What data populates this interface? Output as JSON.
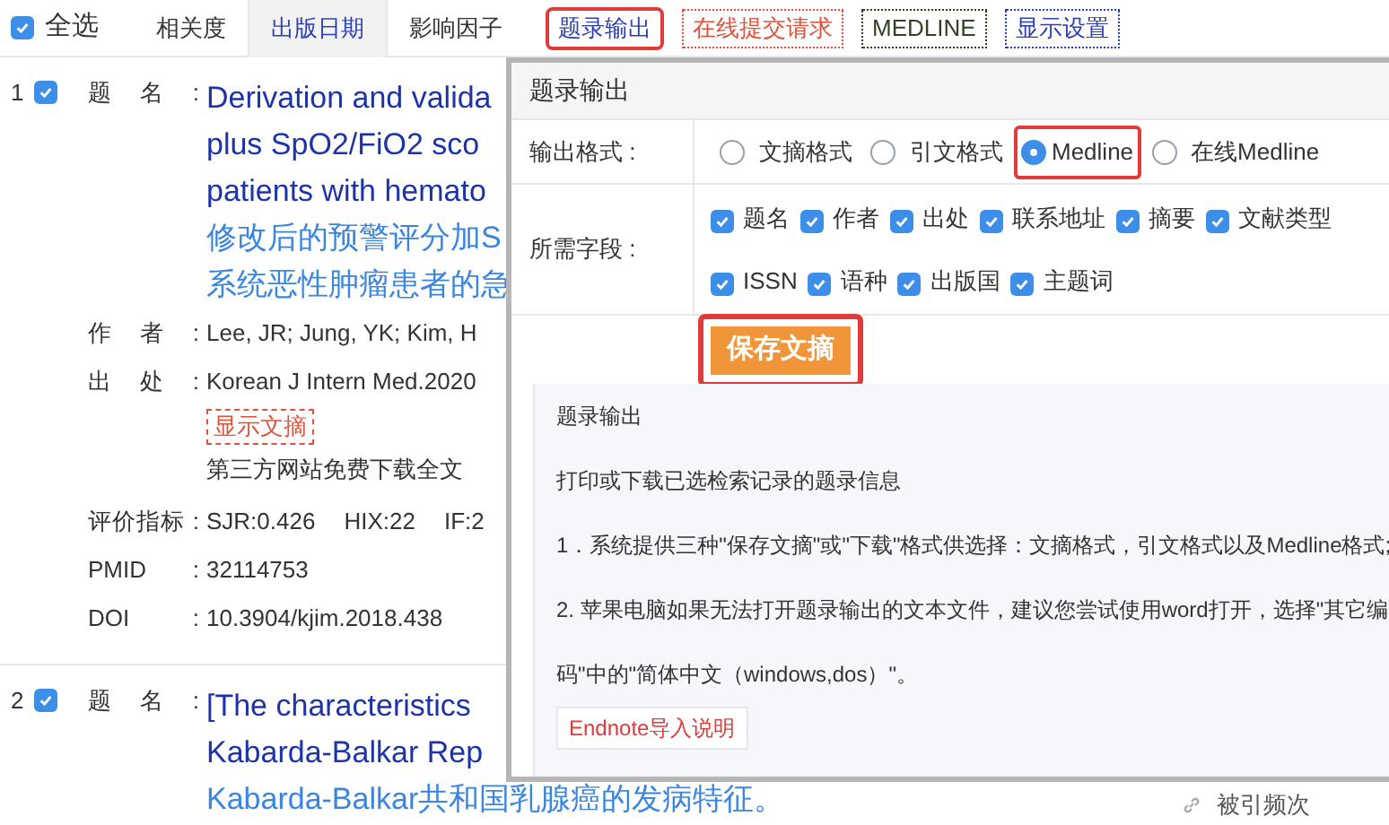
{
  "toolbar": {
    "select_all": {
      "label": "全选",
      "checked": true
    },
    "sort_tabs": [
      {
        "label": "相关度",
        "selected": false
      },
      {
        "label": "出版日期",
        "selected": true
      },
      {
        "label": "影响因子",
        "selected": false
      }
    ],
    "actions": [
      {
        "label": "题录输出",
        "color": "#2b3fb5",
        "highlighted": true
      },
      {
        "label": "在线提交请求",
        "color": "#e0523a",
        "highlighted": false
      },
      {
        "label": "MEDLINE",
        "color": "#334022",
        "highlighted": false
      },
      {
        "label": "显示设置",
        "color": "#2b3fb5",
        "highlighted": false
      }
    ]
  },
  "records": [
    {
      "number": "1",
      "checked": true,
      "fields": [
        {
          "kind": "title",
          "label": "题 名 :",
          "lines_en": [
            "Derivation and valida",
            "plus SpO2/FiO2 sco",
            "patients with hemato"
          ],
          "lines_zh": [
            "修改后的预警评分加S",
            "系统恶性肿瘤患者的急"
          ]
        },
        {
          "kind": "text",
          "label": "作 者 :",
          "value": "Lee, JR; Jung, YK; Kim, H"
        },
        {
          "kind": "text",
          "label": "出 处 :",
          "value": "Korean J Intern Med.2020"
        },
        {
          "kind": "links",
          "abstract_button": "显示文摘",
          "fulltext": "第三方网站免费下载全文"
        },
        {
          "kind": "metrics",
          "label": "评价指标 :",
          "values": [
            "SJR:0.426",
            "HIX:22",
            "IF:2"
          ]
        },
        {
          "kind": "text",
          "label": "PMID :",
          "value": "32114753"
        },
        {
          "kind": "text",
          "label": "DOI :",
          "value": "10.3904/kjim.2018.438"
        }
      ]
    },
    {
      "number": "2",
      "checked": true,
      "fields": [
        {
          "kind": "title",
          "label": "题 名 :",
          "lines_en": [
            "[The characteristics",
            "Kabarda-Balkar Rep"
          ],
          "lines_zh": [
            "Kabarda-Balkar共和国乳腺癌的发病特征。"
          ]
        }
      ]
    }
  ],
  "citations_label": "被引频次",
  "export_panel": {
    "title": "题录输出",
    "format": {
      "label": "输出格式 :",
      "options": [
        {
          "label": "文摘格式",
          "selected": false,
          "highlighted": false
        },
        {
          "label": "引文格式",
          "selected": false,
          "highlighted": false
        },
        {
          "label": "Medline",
          "selected": true,
          "highlighted": true
        },
        {
          "label": "在线Medline",
          "selected": false,
          "highlighted": false
        }
      ]
    },
    "fields": {
      "label": "所需字段 :",
      "options": [
        {
          "label": "题名",
          "checked": true
        },
        {
          "label": "作者",
          "checked": true
        },
        {
          "label": "出处",
          "checked": true
        },
        {
          "label": "联系地址",
          "checked": true
        },
        {
          "label": "摘要",
          "checked": true
        },
        {
          "label": "文献类型",
          "checked": true
        },
        {
          "label": "ISSN",
          "checked": true
        },
        {
          "label": "语种",
          "checked": true
        },
        {
          "label": "出版国",
          "checked": true
        },
        {
          "label": "主题词",
          "checked": true
        }
      ]
    },
    "save_button": {
      "label": "保存文摘",
      "highlighted": true
    },
    "help": {
      "title": "题录输出",
      "paragraphs": [
        "打印或下载已选检索记录的题录信息",
        "1．系统提供三种\"保存文摘\"或\"下载\"格式供选择：文摘格式，引文格式以及Medline格式;",
        "2. 苹果电脑如果无法打开题录输出的文本文件，建议您尝试使用word打开，选择\"其它编",
        "码\"中的\"简体中文（windows,dos）\"。"
      ],
      "endnote_button": "Endnote导入说明"
    }
  }
}
